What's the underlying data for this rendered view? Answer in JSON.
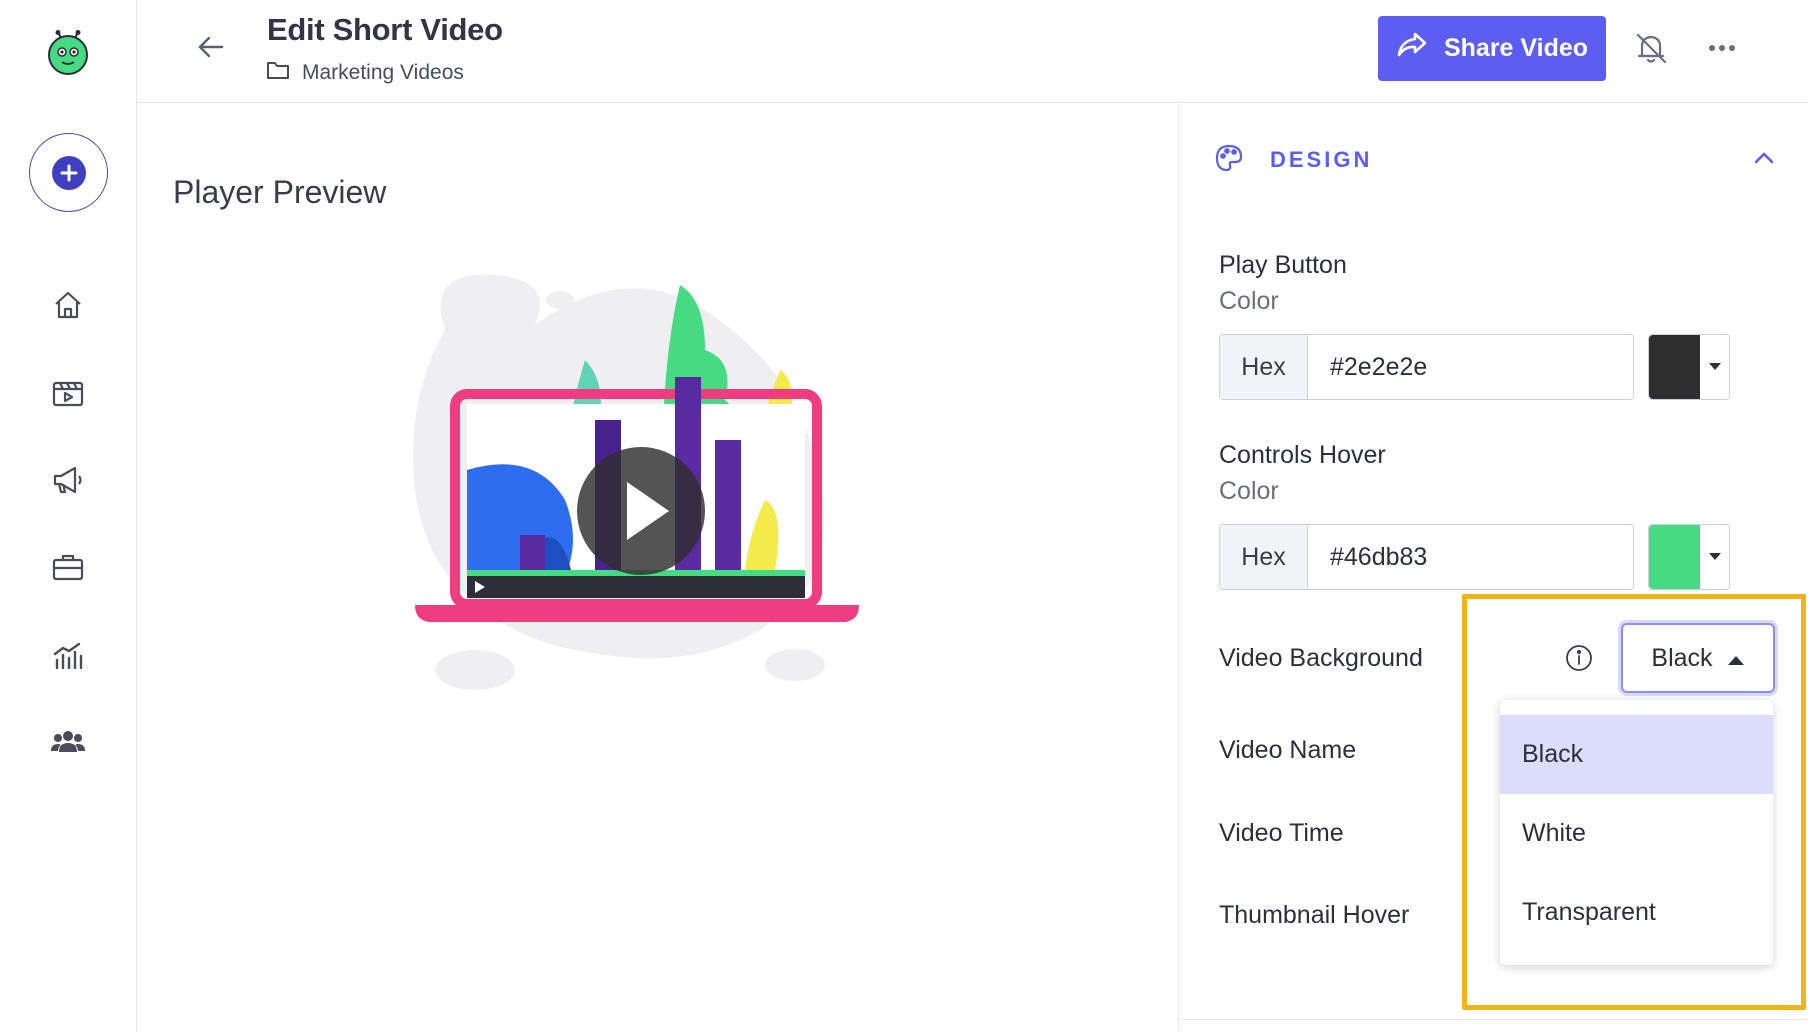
{
  "header": {
    "title": "Edit Short Video",
    "folder": "Marketing Videos",
    "share_label": "Share Video",
    "share_color": "#5b5ef0"
  },
  "sidebar": {
    "items": [
      {
        "icon": "home-icon"
      },
      {
        "icon": "video-library-icon"
      },
      {
        "icon": "megaphone-icon"
      },
      {
        "icon": "briefcase-icon"
      },
      {
        "icon": "analytics-icon"
      },
      {
        "icon": "team-icon"
      }
    ]
  },
  "main": {
    "preview_title": "Player Preview"
  },
  "panel": {
    "section_title": "DESIGN",
    "play_button": {
      "label": "Play Button",
      "sublabel": "Color",
      "prefix": "Hex",
      "value": "#2e2e2e",
      "swatch": "#2e2e2e"
    },
    "controls_hover": {
      "label": "Controls Hover",
      "sublabel": "Color",
      "prefix": "Hex",
      "value": "#46db83",
      "swatch": "#46db83"
    },
    "video_background": {
      "label": "Video Background",
      "selected": "Black",
      "options": [
        "Black",
        "White",
        "Transparent"
      ]
    },
    "video_name_label": "Video Name",
    "video_time_label": "Video Time",
    "thumbnail_hover_label": "Thumbnail Hover"
  }
}
